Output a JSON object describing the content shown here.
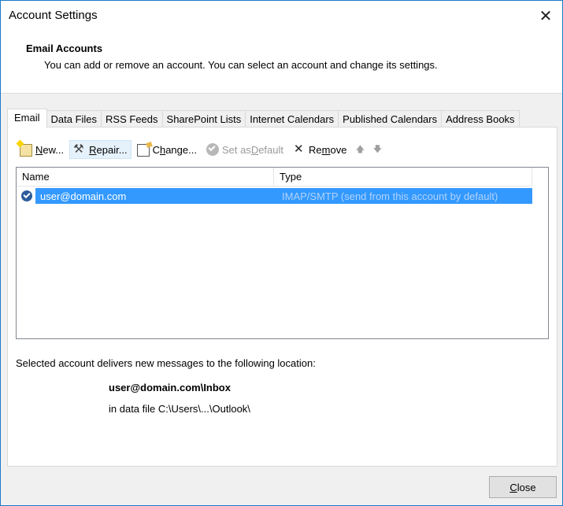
{
  "window": {
    "title": "Account Settings",
    "close_glyph": "✕"
  },
  "header": {
    "title": "Email Accounts",
    "description": "You can add or remove an account. You can select an account and change its settings."
  },
  "tabs": [
    {
      "label": "Email"
    },
    {
      "label": "Data Files"
    },
    {
      "label": "RSS Feeds"
    },
    {
      "label": "SharePoint Lists"
    },
    {
      "label": "Internet Calendars"
    },
    {
      "label": "Published Calendars"
    },
    {
      "label": "Address Books"
    }
  ],
  "toolbar": {
    "new": {
      "pre": "",
      "acc": "N",
      "post": "ew..."
    },
    "repair": {
      "pre": "",
      "acc": "R",
      "post": "epair..."
    },
    "change": {
      "pre": "C",
      "acc": "h",
      "post": "ange..."
    },
    "set_default": {
      "pre": "Set as ",
      "acc": "D",
      "post": "efault"
    },
    "remove": {
      "pre": "Re",
      "acc": "m",
      "post": "ove"
    },
    "up_glyph": "🡅",
    "down_glyph": "🡇"
  },
  "list": {
    "columns": [
      "Name",
      "Type"
    ],
    "rows": [
      {
        "name": "user@domain.com",
        "type": "IMAP/SMTP (send from this account by default)"
      }
    ]
  },
  "delivery": {
    "label": "Selected account delivers new messages to the following location:",
    "path": "user@domain.com\\Inbox",
    "data_file": "in data file C:\\Users\\...\\Outlook\\"
  },
  "footer": {
    "close_acc": "C",
    "close_post": "lose"
  },
  "colors": {
    "selection": "#3399ff",
    "window_border": "#1979ca"
  },
  "icons": {
    "new": "new-account-icon",
    "repair": "repair-tools-icon",
    "change": "change-settings-icon",
    "set_default": "default-check-icon",
    "remove": "remove-x-icon",
    "account": "default-account-check-icon"
  }
}
